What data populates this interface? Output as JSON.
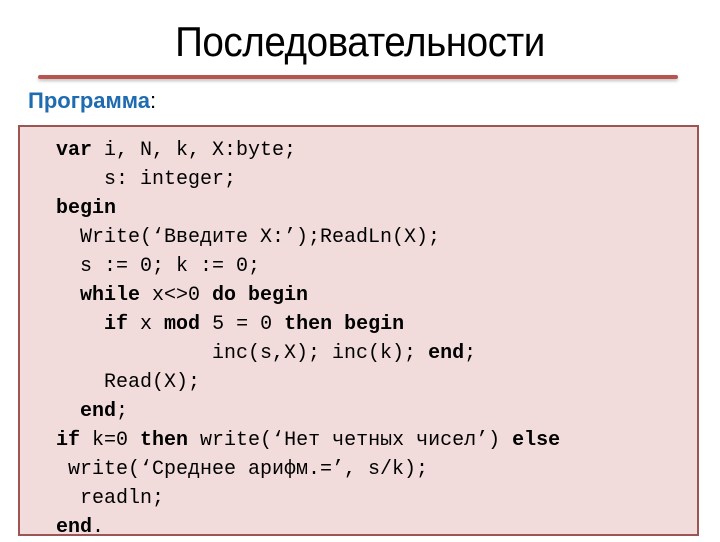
{
  "slide": {
    "title": "Последовательности",
    "subheading": "Программа",
    "subheading_suffix": ":",
    "colors": {
      "title_text": "#000000",
      "divider": "#b85450",
      "subheading": "#1f6bb0",
      "code_background": "#f2dcdb",
      "code_border": "#9c5552"
    }
  },
  "code": {
    "language": "Pascal",
    "lines": [
      [
        {
          "t": "var",
          "kw": true
        },
        {
          "t": " i, N, k, X:byte;"
        }
      ],
      [
        {
          "t": "    s: integer;"
        }
      ],
      [
        {
          "t": "begin",
          "kw": true
        }
      ],
      [
        {
          "t": "  Write(‘Введите X:’);ReadLn(X);"
        }
      ],
      [
        {
          "t": "  s := 0; k := 0;"
        }
      ],
      [
        {
          "t": "  "
        },
        {
          "t": "while",
          "kw": true
        },
        {
          "t": " x<>0 "
        },
        {
          "t": "do begin",
          "kw": true
        }
      ],
      [
        {
          "t": "    "
        },
        {
          "t": "if",
          "kw": true
        },
        {
          "t": " x "
        },
        {
          "t": "mod",
          "kw": true
        },
        {
          "t": " 5 = 0 "
        },
        {
          "t": "then begin",
          "kw": true
        }
      ],
      [
        {
          "t": "             inc(s,X); inc(k); "
        },
        {
          "t": "end",
          "kw": true
        },
        {
          "t": ";"
        }
      ],
      [
        {
          "t": "    Read(X);"
        }
      ],
      [
        {
          "t": "  "
        },
        {
          "t": "end",
          "kw": true
        },
        {
          "t": ";"
        }
      ],
      [
        {
          "t": "if",
          "kw": true
        },
        {
          "t": " k=0 "
        },
        {
          "t": "then",
          "kw": true
        },
        {
          "t": " write(‘Нет четных чисел’) "
        },
        {
          "t": "else",
          "kw": true
        }
      ],
      [
        {
          "t": " write(‘Среднее арифм.=’, s/k);"
        }
      ],
      [
        {
          "t": "  readln;"
        }
      ],
      [
        {
          "t": "end",
          "kw": true
        },
        {
          "t": "."
        }
      ]
    ]
  }
}
